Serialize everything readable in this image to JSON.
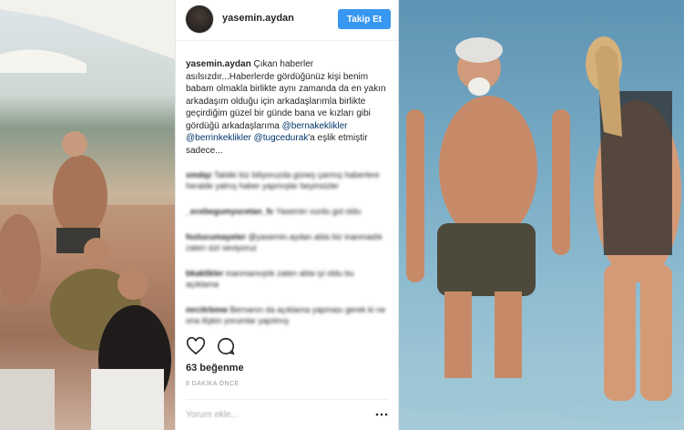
{
  "post": {
    "username": "yasemin.aydan",
    "follow_label": "Takip Et",
    "caption_username": "yasemin.aydan",
    "caption_text": "Çıkan haberler asılsızdır...Haberlerde gördüğünüz kişi benim babam olmakla birlikte aynı zamanda da en yakın arkadaşım olduğu için arkadaşlarımla birlikte geçirdiğim güzel bir günde bana ve kızları gibi gördüğü arkadaşlarıma",
    "mentions": [
      "@bernakeklikler",
      "@berrinkeklikler",
      "@tugcedurak"
    ],
    "caption_tail": "'a eşlik etmiştir sadece...",
    "comments": [
      {
        "user": "smdqz",
        "text": "Tabiiki biz biliyoruzda güneş çarmış haberlere heralde yalnış haber yapmışlar beyinsizler"
      },
      {
        "user": "_ecebegumyucetan_fc",
        "text": "Yasemin vurdu gol oldu"
      },
      {
        "user": "fozlucumayeter",
        "text": "@yasemin.aydan abla biz inanmadık zaten sizi seviyoruz"
      },
      {
        "user": "bkaklikler",
        "text": "inanmamıştık zaten abla iyi oldu bu açıklama"
      },
      {
        "user": "mrcitrbmw",
        "text": "Bernanın da açıklama yapması gerek ki ne ona ilişkin yorumlar yapılmış"
      }
    ],
    "likes_label": "63 beğenme",
    "time_label": "8 DAKİKA ÖNCE",
    "comment_placeholder": "Yorum ekle..."
  },
  "icons": [
    "heart-icon",
    "comment-icon",
    "more-options-icon"
  ],
  "colors": {
    "follow_button": "#3897f0",
    "mention": "#003569",
    "text": "#262626"
  }
}
